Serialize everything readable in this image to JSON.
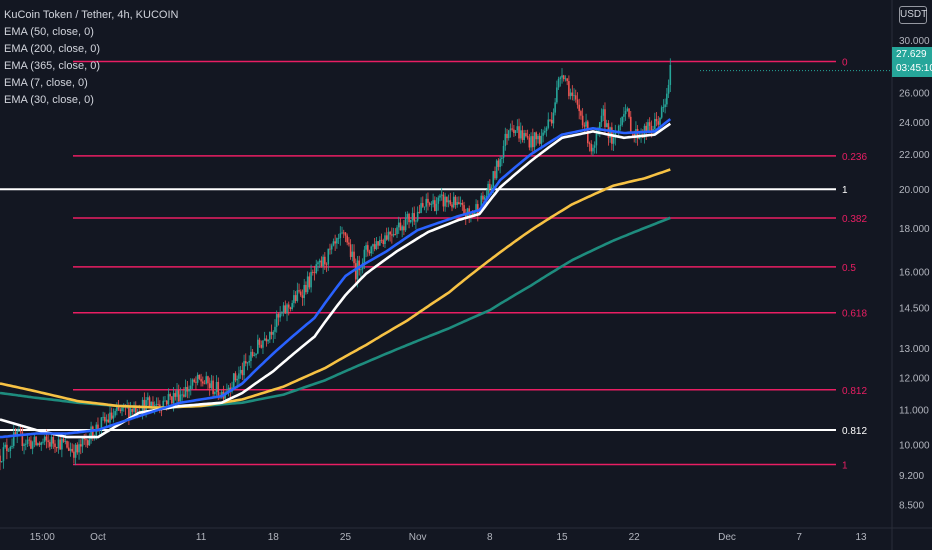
{
  "legend": {
    "symbol": "KuCoin Token / Tether, 4h, KUCOIN",
    "indicators": [
      "EMA (50, close, 0)",
      "EMA (200, close, 0)",
      "EMA (365, close, 0)",
      "EMA (7, close, 0)",
      "EMA (30, close, 0)"
    ]
  },
  "currency_button": "USDT",
  "last_price": {
    "value": "27.629",
    "countdown": "03:45:10"
  },
  "colors": {
    "background": "#131722",
    "fib_line": "#e91e63",
    "white_line": "#ffffff",
    "ema50": "#2962ff",
    "ema200": "#f7c244",
    "ema365": "#1e8c7e",
    "ema30": "#ffffff",
    "ema7": "#ff6f6f",
    "candle_up": "#26a69a",
    "candle_down": "#ef5350",
    "price_box": "#26a69a"
  },
  "chart_data": {
    "type": "line",
    "title": "KuCoin Token / Tether, 4h, KUCOIN",
    "y_scale": "log",
    "ylim": [
      8.1,
      31.5
    ],
    "y_ticks": [
      "30.000",
      "28.000",
      "26.000",
      "24.000",
      "22.000",
      "20.000",
      "18.000",
      "16.000",
      "14.500",
      "13.000",
      "12.000",
      "11.000",
      "10.000",
      "9.200",
      "8.500"
    ],
    "y_tick_values": [
      30,
      28,
      26,
      24,
      22,
      20,
      18,
      16,
      14.5,
      13,
      12,
      11,
      10,
      9.2,
      8.5
    ],
    "x_ticks": [
      "15:00",
      "Oct",
      "11",
      "18",
      "25",
      "Nov",
      "8",
      "15",
      "22",
      "Dec",
      "7",
      "13"
    ],
    "x_tick_days": [
      -4.4,
      1,
      11,
      18,
      25,
      32,
      39,
      46,
      53,
      62,
      69,
      75
    ],
    "x_axis_note": "days counted from Oct 1",
    "xlim": [
      -8.5,
      78
    ],
    "fib_levels": [
      {
        "label": "0",
        "value": 28.3,
        "color": "#e91e63"
      },
      {
        "label": "0.236",
        "value": 21.9,
        "color": "#e91e63"
      },
      {
        "label": "1",
        "value": 20.0,
        "color": "#ffffff"
      },
      {
        "label": "0.382",
        "value": 18.5,
        "color": "#e91e63"
      },
      {
        "label": "0.5",
        "value": 16.2,
        "color": "#e91e63"
      },
      {
        "label": "0.618",
        "value": 14.3,
        "color": "#e91e63"
      },
      {
        "label": "0.812",
        "value": 11.6,
        "color": "#e91e63"
      },
      {
        "label": "0.812",
        "value": 10.4,
        "color": "#ffffff"
      },
      {
        "label": "1",
        "value": 9.47,
        "color": "#e91e63"
      }
    ],
    "price_path": {
      "x": [
        -8.5,
        -7,
        -5,
        -3,
        -1,
        0,
        1,
        3,
        5,
        7,
        9,
        11,
        13,
        15,
        17,
        19,
        21,
        23,
        25,
        26,
        27,
        29,
        31,
        33,
        35,
        37,
        38,
        39,
        40,
        41,
        42,
        43,
        44,
        45,
        46,
        47,
        48,
        49,
        50,
        51,
        52,
        53,
        54,
        55,
        56,
        56.5
      ],
      "y": [
        9.7,
        10.2,
        10.0,
        10.1,
        9.8,
        10.2,
        10.5,
        10.9,
        11.1,
        11.2,
        11.5,
        11.9,
        11.5,
        12.2,
        13.3,
        14.3,
        15.3,
        16.5,
        17.7,
        16.0,
        16.9,
        17.7,
        18.4,
        19.2,
        19.4,
        18.6,
        19.2,
        20.0,
        21.8,
        24.0,
        23.2,
        22.8,
        23.0,
        24.4,
        27.8,
        25.6,
        24.3,
        22.0,
        24.4,
        22.6,
        25.0,
        23.2,
        23.4,
        23.8,
        25.0,
        27.6
      ]
    },
    "series": [
      {
        "name": "EMA (50, close, 0)",
        "color": "#2962ff",
        "x": [
          -8.5,
          -5,
          -2,
          1,
          5,
          9,
          13,
          15,
          18,
          22,
          25,
          26,
          29,
          32,
          36,
          38,
          40,
          43,
          46,
          49,
          52,
          55,
          56.5
        ],
        "y": [
          10.2,
          10.3,
          10.3,
          10.4,
          10.8,
          11.2,
          11.4,
          11.8,
          12.8,
          14.1,
          15.8,
          16.1,
          16.9,
          17.9,
          18.6,
          18.9,
          20.5,
          22.0,
          23.2,
          23.6,
          23.3,
          23.4,
          24.2
        ]
      },
      {
        "name": "EMA (30, close, 0)",
        "color": "#ffffff",
        "x": [
          -8.5,
          -5,
          -2,
          1,
          5,
          9,
          13,
          15,
          18,
          22,
          25,
          27,
          30,
          33,
          36,
          38,
          40,
          43,
          46,
          49,
          52,
          55,
          56.5
        ],
        "y": [
          10.7,
          10.4,
          10.2,
          10.2,
          10.9,
          11.1,
          11.2,
          11.5,
          12.2,
          13.4,
          15.0,
          15.9,
          16.9,
          17.8,
          18.4,
          18.7,
          20.1,
          21.6,
          23.0,
          23.4,
          23.0,
          23.2,
          23.9
        ]
      },
      {
        "name": "EMA (200, close, 0)",
        "color": "#f7c244",
        "x": [
          -8.5,
          -5,
          -1,
          3,
          7,
          11,
          15,
          19,
          23,
          27,
          31,
          35,
          39,
          43,
          47,
          51,
          54,
          56.5
        ],
        "y": [
          11.8,
          11.55,
          11.25,
          11.1,
          11.05,
          11.1,
          11.3,
          11.7,
          12.3,
          13.1,
          14.0,
          15.1,
          16.5,
          17.9,
          19.2,
          20.2,
          20.6,
          21.1
        ]
      },
      {
        "name": "EMA (365, close, 0)",
        "color": "#1e8c7e",
        "x": [
          -8.5,
          -5,
          -1,
          3,
          7,
          11,
          15,
          19,
          23,
          27,
          31,
          35,
          39,
          43,
          47,
          51,
          54,
          56.5
        ],
        "y": [
          11.5,
          11.35,
          11.2,
          11.1,
          11.05,
          11.1,
          11.2,
          11.45,
          11.9,
          12.5,
          13.1,
          13.7,
          14.4,
          15.4,
          16.5,
          17.4,
          18.0,
          18.5
        ]
      }
    ]
  }
}
